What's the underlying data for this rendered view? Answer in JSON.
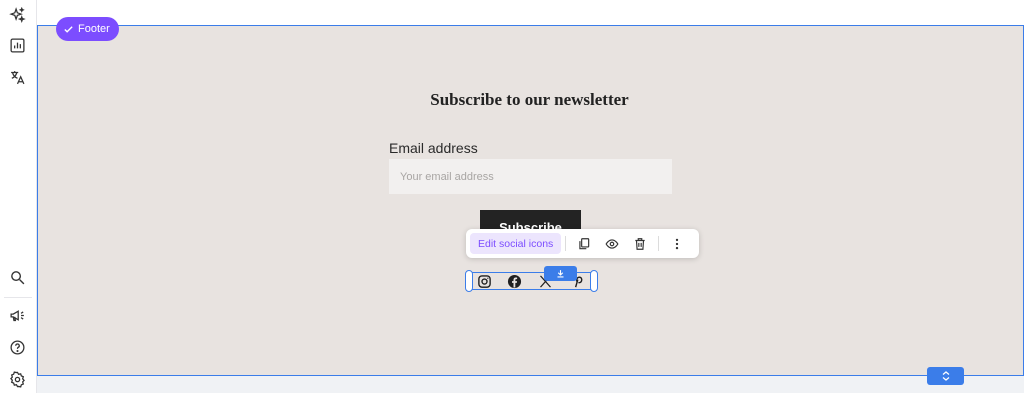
{
  "rail": {
    "top_items": [
      {
        "icon": "sparkle-icon"
      },
      {
        "icon": "analytics-icon"
      },
      {
        "icon": "translate-icon"
      }
    ],
    "bottom_items": [
      {
        "icon": "search-icon"
      },
      {
        "icon": "megaphone-icon"
      },
      {
        "icon": "help-icon"
      },
      {
        "icon": "settings-icon"
      }
    ]
  },
  "footer": {
    "tag_label": "Footer",
    "newsletter_title": "Subscribe to our newsletter",
    "email_label": "Email address",
    "email_placeholder": "Your email address",
    "email_value": "",
    "subscribe_label": "Subscribe"
  },
  "toolbar": {
    "edit_label": "Edit social icons",
    "actions": [
      "duplicate-icon",
      "preview-icon",
      "delete-icon",
      "more-icon"
    ]
  },
  "social": {
    "icons": [
      "instagram-icon",
      "facebook-icon",
      "x-icon",
      "pinterest-icon"
    ]
  },
  "colors": {
    "accent": "#7c4dff",
    "selection": "#3b7de9",
    "footer_bg": "#e8e3e0",
    "button_bg": "#232323"
  }
}
